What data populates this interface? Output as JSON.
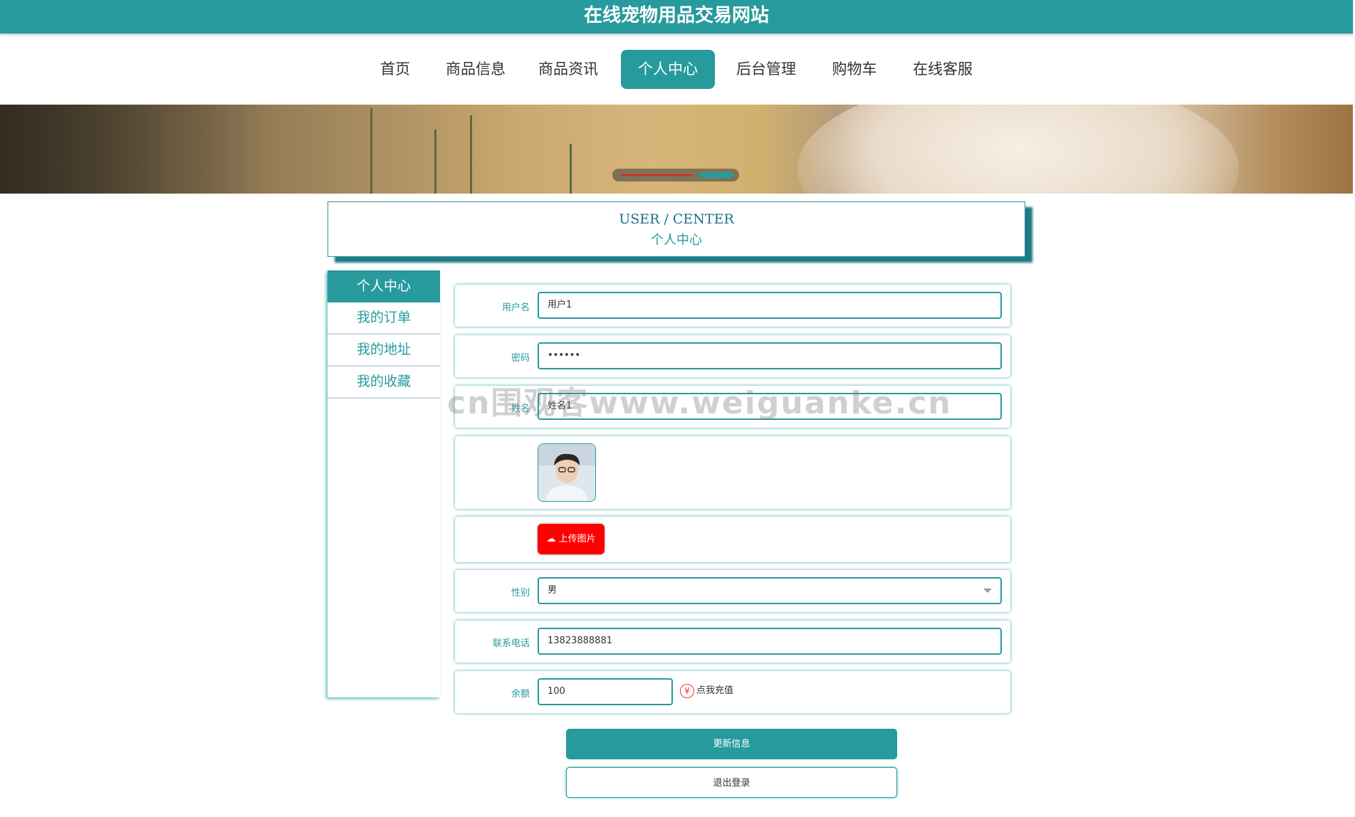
{
  "site": {
    "title": "在线宠物用品交易网站"
  },
  "nav": {
    "items": [
      "首页",
      "商品信息",
      "商品资讯",
      "个人中心",
      "后台管理",
      "购物车",
      "在线客服"
    ],
    "active": "个人中心"
  },
  "user_center": {
    "title_en": "USER / CENTER",
    "title_cn": "个人中心"
  },
  "sidebar": {
    "items": [
      "个人中心",
      "我的订单",
      "我的地址",
      "我的收藏"
    ],
    "active": "个人中心"
  },
  "form": {
    "username": {
      "label": "用户名",
      "value": "用户1"
    },
    "password": {
      "label": "密码",
      "value": "••••••"
    },
    "name": {
      "label": "姓名",
      "value": "姓名1"
    },
    "upload_label": "上传图片",
    "gender": {
      "label": "性别",
      "value": "男"
    },
    "phone": {
      "label": "联系电话",
      "value": "13823888881"
    },
    "balance": {
      "label": "余额",
      "value": "100",
      "recharge": "点我充值",
      "currency_symbol": "¥"
    }
  },
  "buttons": {
    "update": "更新信息",
    "logout": "退出登录"
  },
  "watermark": "cn围观客www.weiguanke.cn",
  "colors": {
    "accent": "#279a9d",
    "upload": "#ff0000"
  }
}
